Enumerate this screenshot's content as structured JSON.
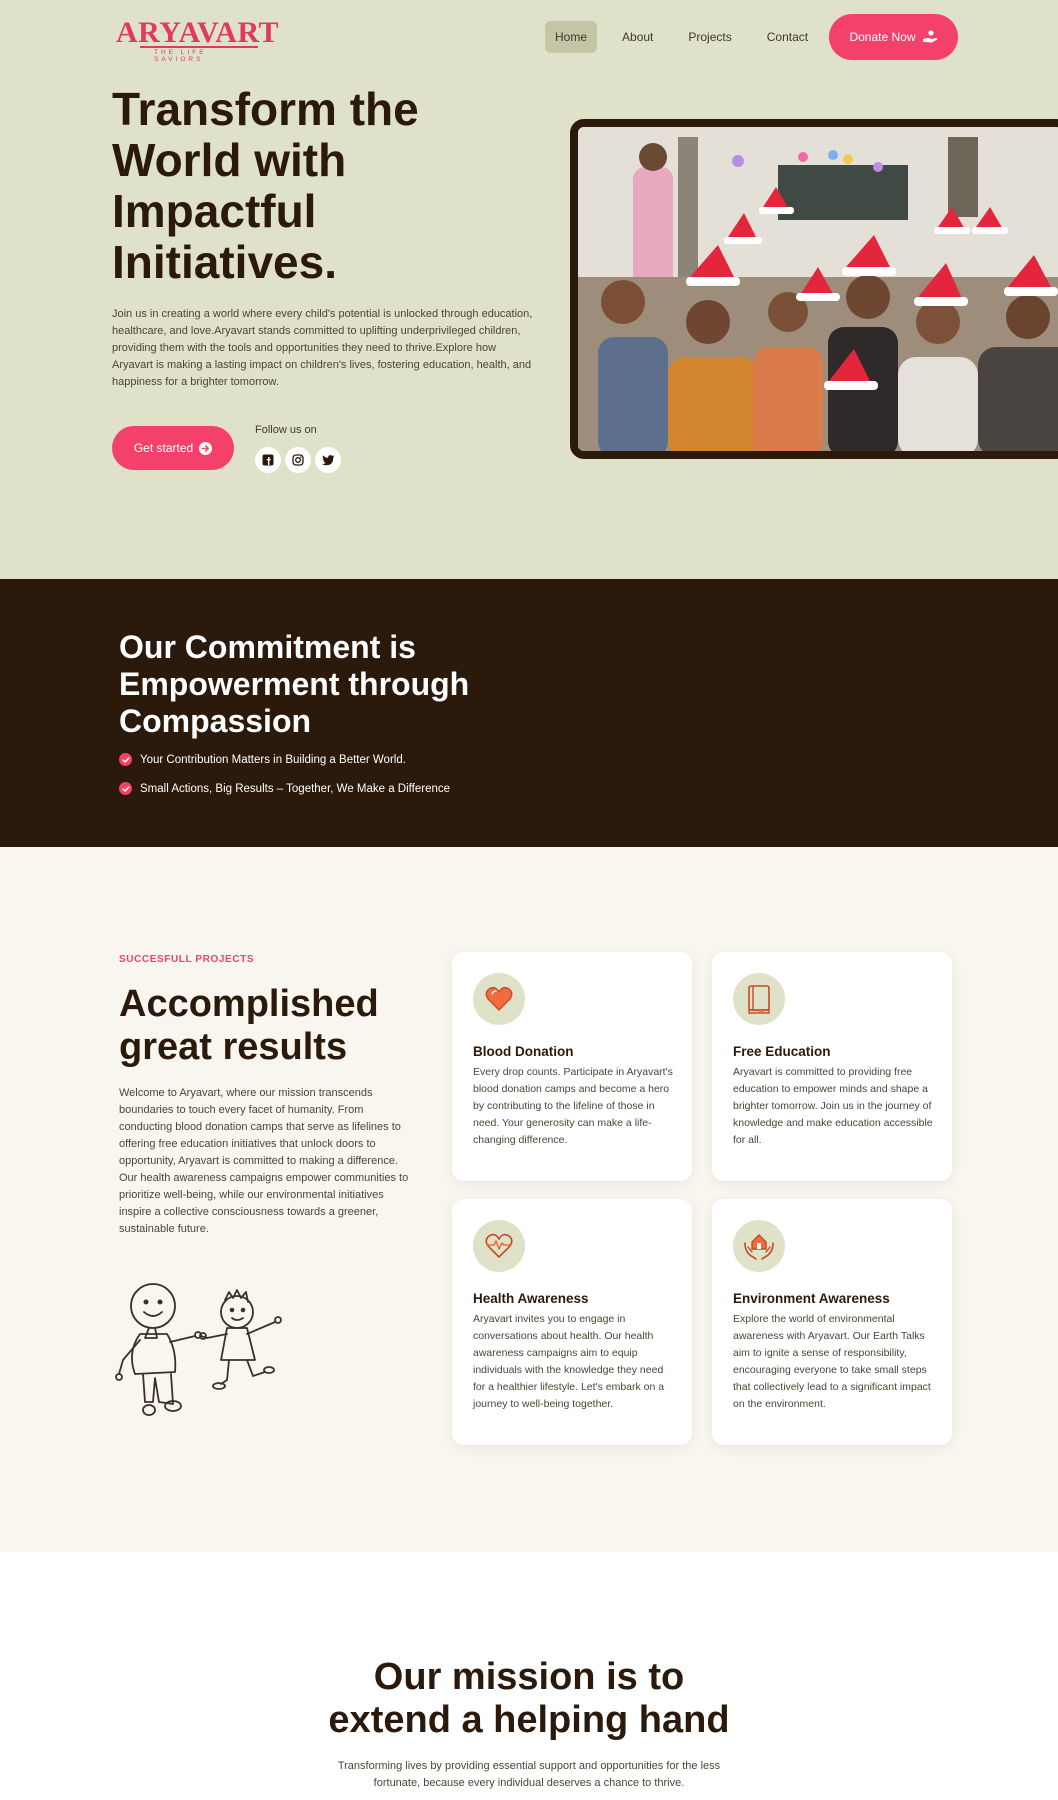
{
  "brand": {
    "name": "ARYAVART",
    "tagline": "THE LIFE SAVIORS"
  },
  "nav": {
    "items": [
      {
        "label": "Home",
        "active": true
      },
      {
        "label": "About",
        "active": false
      },
      {
        "label": "Projects",
        "active": false
      },
      {
        "label": "Contact",
        "active": false
      }
    ],
    "donate_label": "Donate Now"
  },
  "hero": {
    "title": "Transform the World with Impactful Initiatives.",
    "description": "Join us in creating a world where every child's potential is unlocked through education, healthcare, and love.Aryavart stands committed to uplifting underprivileged children, providing them with the tools and opportunities they need to thrive.Explore how Aryavart is making a lasting impact on children's lives, fostering education, health, and happiness for a brighter tomorrow.",
    "cta_label": "Get started",
    "follow_label": "Follow us on",
    "socials": [
      "facebook-icon",
      "instagram-icon",
      "twitter-icon"
    ]
  },
  "commitment": {
    "title": "Our Commitment is Empowerment through Compassion",
    "items": [
      "Your Contribution Matters in Building a Better World.",
      "Small Actions, Big Results – Together, We Make a Difference"
    ]
  },
  "projects": {
    "kicker": "SUCCESFULL PROJECTS",
    "title": "Accomplished great results",
    "description": "Welcome to Aryavart, where our mission transcends boundaries to touch every facet of humanity. From conducting blood donation camps that serve as lifelines to offering free education initiatives that unlock doors to opportunity, Aryavart is committed to making a difference. Our health awareness campaigns empower communities to prioritize well-being, while our environmental initiatives inspire a collective consciousness towards a greener, sustainable future.",
    "cards": [
      {
        "icon": "heart-icon",
        "title": "Blood Donation",
        "description": "Every drop counts. Participate in Aryavart's blood donation camps and become a hero by contributing to the lifeline of those in need. Your generosity can make a life-changing difference."
      },
      {
        "icon": "book-icon",
        "title": "Free Education",
        "description": "Aryavart is committed to providing free education to empower minds and shape a brighter tomorrow. Join us in the journey of knowledge and make education accessible for all."
      },
      {
        "icon": "heartbeat-icon",
        "title": "Health Awareness",
        "description": "Aryavart invites you to engage in conversations about health. Our health awareness campaigns aim to equip individuals with the knowledge they need for a healthier lifestyle. Let's embark on a journey to well-being together."
      },
      {
        "icon": "hands-house-icon",
        "title": "Environment Awareness",
        "description": "Explore the world of environmental awareness with Aryavart. Our Earth Talks aim to ignite a sense of responsibility, encouraging everyone to take small steps that collectively lead to a significant impact on the environment."
      }
    ]
  },
  "mission": {
    "title_line1": "Our mission is to",
    "title_line2": "extend a helping hand",
    "description": "Transforming lives by providing essential support and opportunities for the less fortunate, because every individual deserves a chance to thrive."
  },
  "colors": {
    "accent": "#f4416b",
    "dark": "#2b1a0c",
    "hero_bg": "#dfe1c8",
    "section_bg": "#f8f6ee"
  }
}
